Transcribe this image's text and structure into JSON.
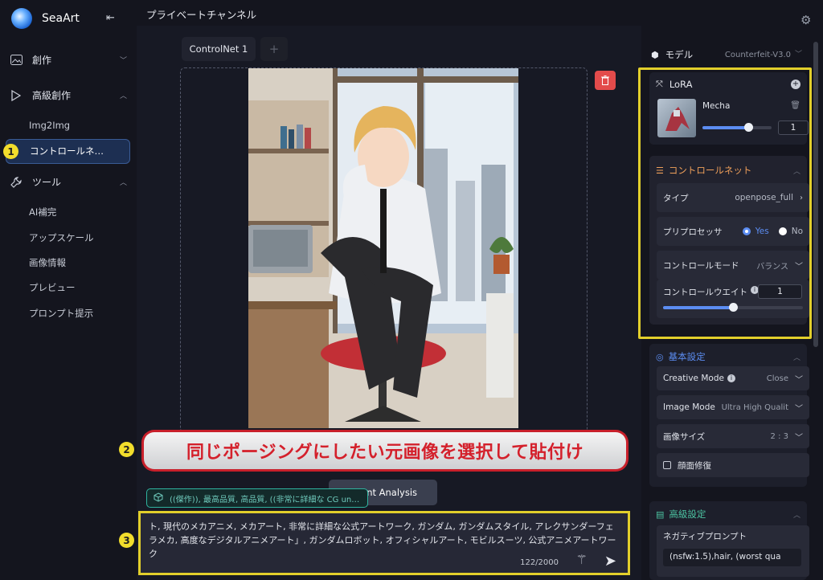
{
  "app": {
    "name": "SeaArt"
  },
  "sidebar": {
    "groups": [
      {
        "label": "創作"
      },
      {
        "label": "高級創作"
      },
      {
        "label": "ツール"
      }
    ],
    "advanced_items": [
      "Img2Img",
      "コントロールネ…"
    ],
    "tool_items": [
      "AI補完",
      "アップスケール",
      "画像情報",
      "プレビュー",
      "プロンプト提示"
    ]
  },
  "topbar": {
    "title": "プライベートチャンネル"
  },
  "main": {
    "tab_label": "ControlNet 1",
    "tab_add": "+",
    "agent_button": "Agent Analysis",
    "chip_text": "((傑作)), 最高品質, 高品質, ((非常に詳細な CG un…",
    "prompt_text": "ト, 現代のメカアニメ, メカアート, 非常に詳細な公式アートワーク, ガンダム, ガンダムスタイル, アレクサンダーフェラメカ, 高度なデジタルアニメアート」, ガンダムロボット, オフィシャルアート, モビルスーツ, 公式アニメアートワーク",
    "prompt_count": "122/2000"
  },
  "annotations": {
    "n1": "1",
    "n2": "2",
    "n3": "3",
    "banner_text": "同じポージングにしたい元画像を選択して貼付け"
  },
  "panel": {
    "model": {
      "label": "モデル",
      "value": "Counterfeit-V3.0"
    },
    "lora": {
      "title": "LoRA",
      "item_name": "Mecha",
      "weight": "1",
      "weight_fraction": 0.66
    },
    "controlnet": {
      "title": "コントロールネット",
      "type_label": "タイプ",
      "type_value": "openpose_full",
      "preprocessor_label": "プリプロセッサ",
      "yes": "Yes",
      "no": "No",
      "mode_label": "コントロールモード",
      "mode_value": "バランス",
      "weight_label": "コントロールウエイト",
      "weight_value": "1",
      "weight_fraction": 0.5
    },
    "basic": {
      "title": "基本設定",
      "creative_label": "Creative Mode",
      "creative_value": "Close",
      "image_mode_label": "Image Mode",
      "image_mode_value": "Ultra High Qualit",
      "size_label": "画像サイズ",
      "size_value": "2 : 3",
      "face_label": "顔面修復"
    },
    "advanced": {
      "title": "高級設定",
      "negative_label": "ネガティブプロンプト",
      "negative_value": "(nsfw:1.5),hair, (worst qua"
    }
  },
  "colors": {
    "accent": "#5c8df2",
    "highlight": "#e2cf2b",
    "banner_red": "#d4202b",
    "controlnet_title": "#f0a05a"
  }
}
